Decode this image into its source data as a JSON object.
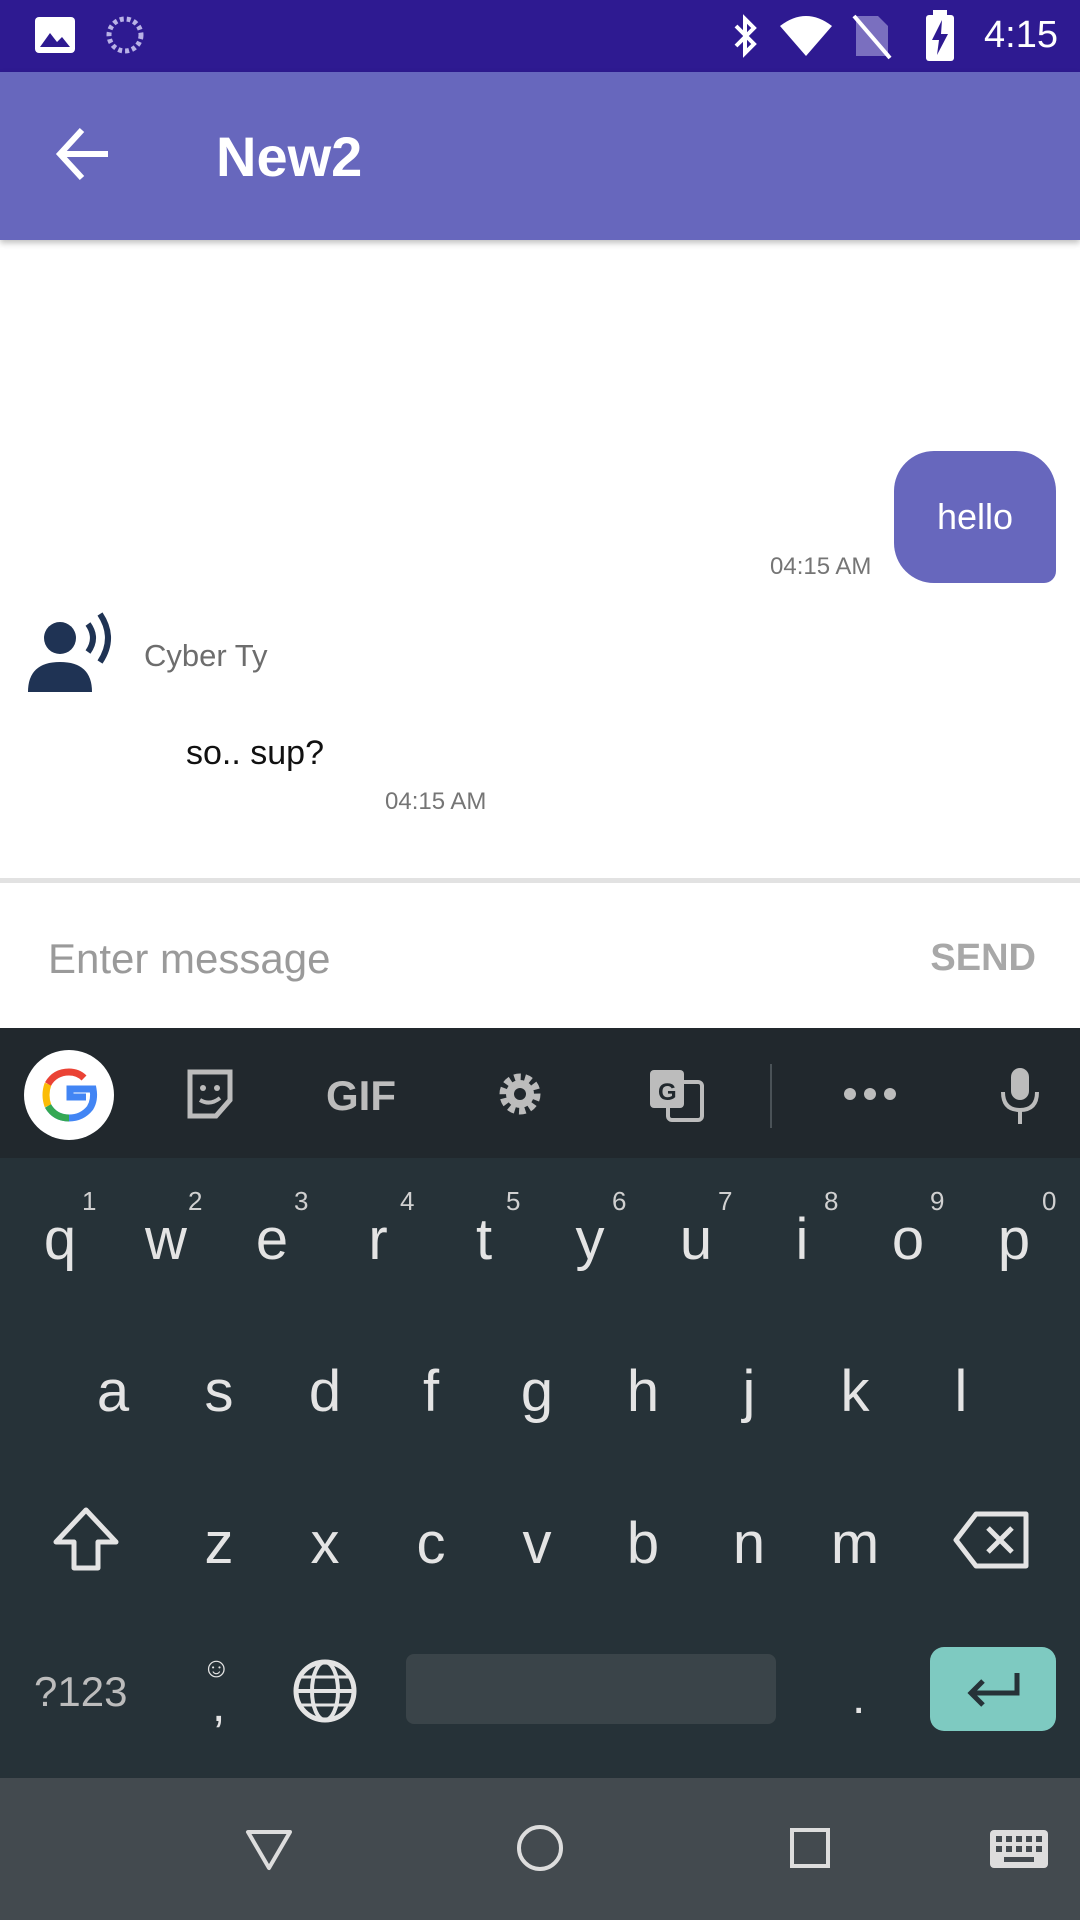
{
  "status_bar": {
    "time": "4:15",
    "icons": [
      "image-icon",
      "sync-icon",
      "bluetooth-icon",
      "wifi-icon",
      "no-sim-icon",
      "battery-charging-icon"
    ]
  },
  "app_bar": {
    "title": "New2",
    "back_icon": "arrow-back-icon"
  },
  "chat": {
    "outgoing": {
      "text": "hello",
      "time": "04:15 AM"
    },
    "incoming": {
      "sender": "Cyber Ty",
      "text": "so.. sup?",
      "time": "04:15 AM",
      "avatar_icon": "record-voice-icon"
    }
  },
  "composer": {
    "placeholder": "Enter message",
    "send_label": "SEND"
  },
  "keyboard": {
    "toolbar_icons": [
      "google-icon",
      "sticker-icon",
      "gif-icon",
      "settings-icon",
      "translate-icon",
      "more-icon",
      "mic-icon"
    ],
    "gif_label": "GIF",
    "row1": [
      "q",
      "w",
      "e",
      "r",
      "t",
      "y",
      "u",
      "i",
      "o",
      "p"
    ],
    "row1_hints": [
      "1",
      "2",
      "3",
      "4",
      "5",
      "6",
      "7",
      "8",
      "9",
      "0"
    ],
    "row2": [
      "a",
      "s",
      "d",
      "f",
      "g",
      "h",
      "j",
      "k",
      "l"
    ],
    "row3": [
      "z",
      "x",
      "c",
      "v",
      "b",
      "n",
      "m"
    ],
    "symbols_label": "?123",
    "comma_label": ",",
    "period_label": "."
  },
  "colors": {
    "status_bar": "#2e1a91",
    "app_bar": "#6767bd",
    "keyboard": "#263238",
    "enter_key": "#7ecac1"
  }
}
